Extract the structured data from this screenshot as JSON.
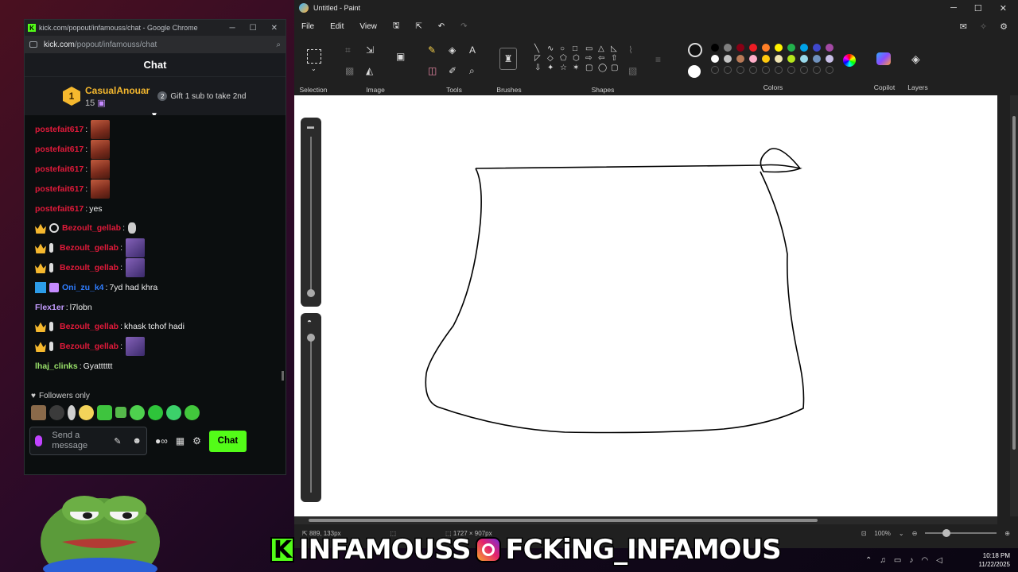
{
  "chrome": {
    "window_title": "kick.com/popout/infamouss/chat - Google Chrome",
    "url_domain": "kick.com",
    "url_path": "/popout/infamouss/chat",
    "favicon_letter": "K"
  },
  "chat": {
    "header": "Chat",
    "top_gifter": {
      "rank": "1",
      "name": "CasualAnouar",
      "count": "15"
    },
    "gift_cta_rank": "2",
    "gift_cta": "Gift 1 sub to take 2nd",
    "messages": [
      {
        "user": "postefait617",
        "text": ""
      },
      {
        "user": "postefait617",
        "text": ""
      },
      {
        "user": "postefait617",
        "text": ""
      },
      {
        "user": "postefait617",
        "text": ""
      },
      {
        "user": "postefait617",
        "text": "yes"
      },
      {
        "user": "Bezoult_gellab",
        "text": ""
      },
      {
        "user": "Bezoult_gellab",
        "text": ""
      },
      {
        "user": "Bezoult_gellab",
        "text": ""
      },
      {
        "user": "Oni_zu_k4",
        "text": "7yd had khra"
      },
      {
        "user": "Flex1er",
        "text": "l7lobn"
      },
      {
        "user": "Bezoult_gellab",
        "text": "khask tchof hadi"
      },
      {
        "user": "Bezoult_gellab",
        "text": ""
      },
      {
        "user": "lhaj_clinks",
        "text": "Gyatttttt"
      }
    ],
    "followers_only": "Followers only",
    "input_placeholder": "Send a message",
    "send_button": "Chat"
  },
  "paint": {
    "window_title": "Untitled - Paint",
    "menu": [
      "File",
      "Edit",
      "View"
    ],
    "groups": {
      "selection": "Selection",
      "image": "Image",
      "tools": "Tools",
      "brushes": "Brushes",
      "shapes": "Shapes",
      "colors": "Colors",
      "copilot": "Copilot",
      "layers": "Layers"
    },
    "palette": [
      "#000000",
      "#7f7f7f",
      "#880015",
      "#ed1c24",
      "#ff7f27",
      "#fff200",
      "#22b14c",
      "#00a2e8",
      "#3f48cc",
      "#a349a4",
      "#ffffff",
      "#c3c3c3",
      "#b97a57",
      "#ffaec9",
      "#ffc90e",
      "#efe4b0",
      "#b5e61d",
      "#99d9ea",
      "#7092be",
      "#c8bfe7"
    ],
    "status": {
      "cursor": "889, 133px",
      "canvas_size": "1727 × 907px",
      "zoom": "100%"
    }
  },
  "banner": {
    "channel": "INFAMOUSS",
    "instagram": "FCKiNG_INFAMOUS",
    "k_letter": "K"
  },
  "tray": {
    "time": "10:18 PM",
    "date": "11/22/2025"
  }
}
